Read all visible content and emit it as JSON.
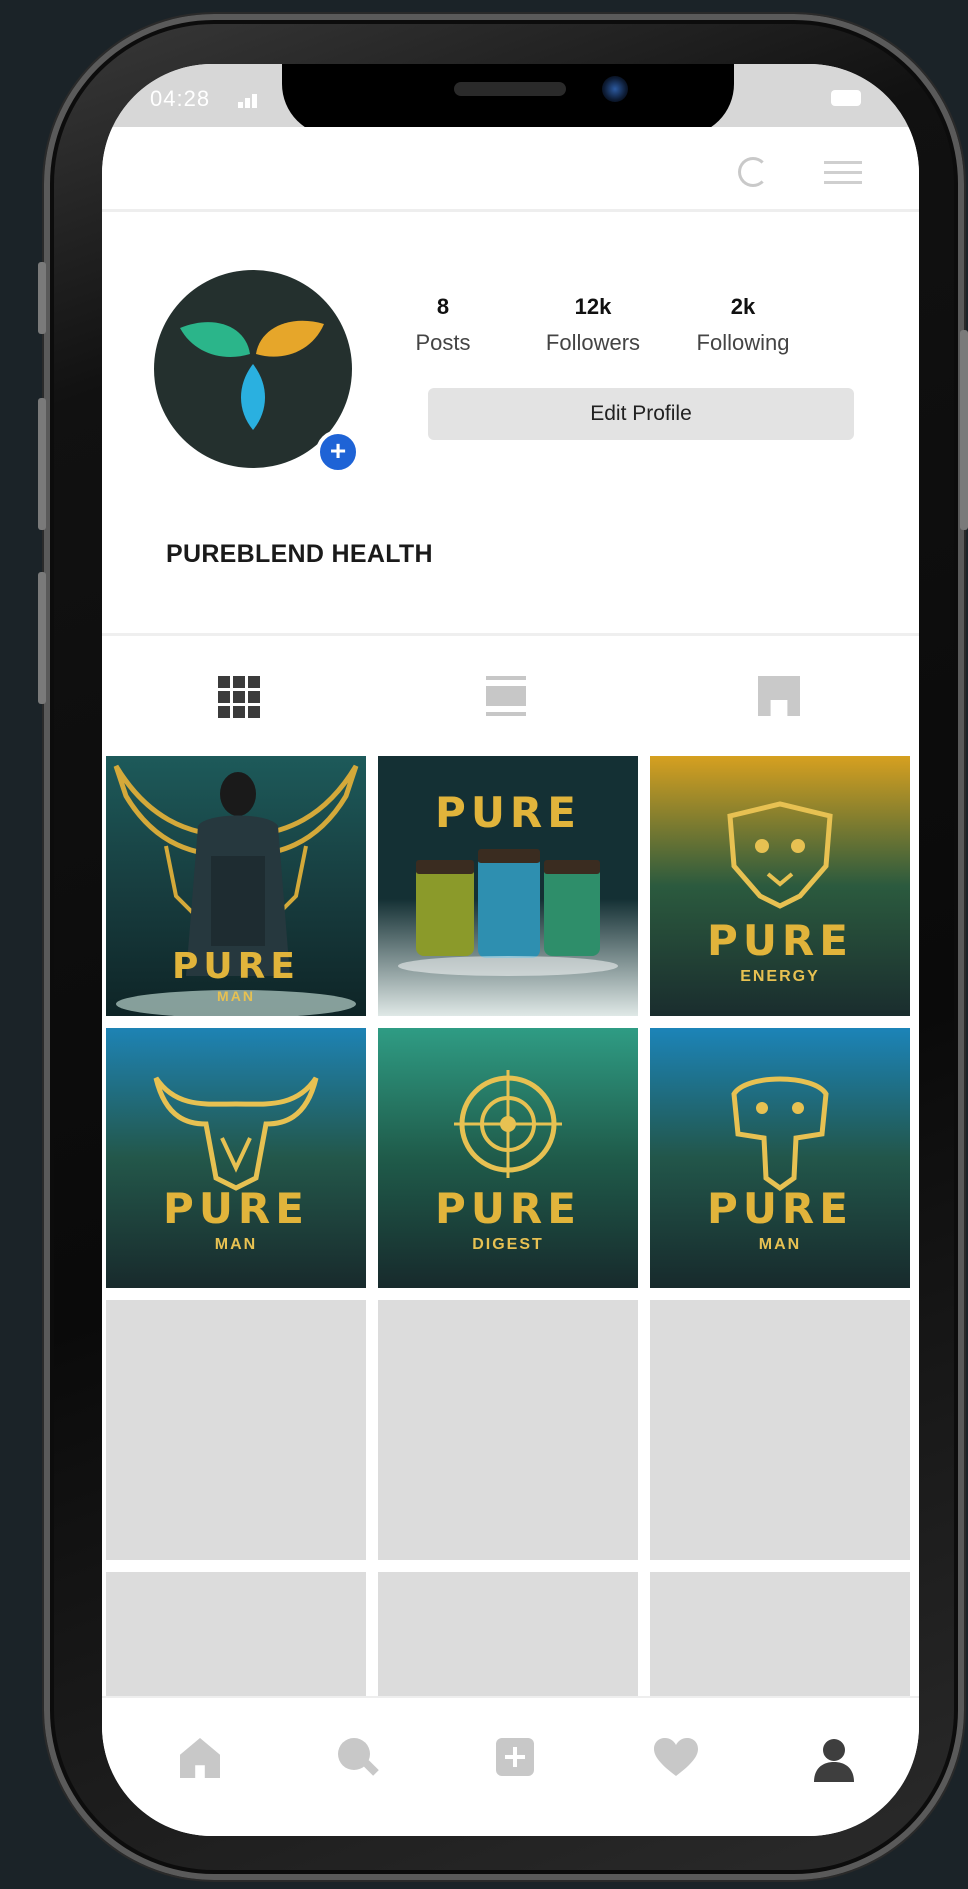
{
  "status_bar": {
    "time": "04:28"
  },
  "profile": {
    "name": "PUREBLEND HEALTH",
    "stats": {
      "posts_value": "8",
      "posts_label": "Posts",
      "followers_value": "12k",
      "followers_label": "Followers",
      "following_value": "2k",
      "following_label": "Following"
    },
    "edit_profile_label": "Edit Profile"
  },
  "tabs": [
    "grid-tab",
    "feed-tab",
    "tagged-tab"
  ],
  "posts": [
    {
      "brand": "PURE",
      "sub": "MAN"
    },
    {
      "brand": "PURE",
      "sub": ""
    },
    {
      "brand": "PURE",
      "sub": "ENERGY"
    },
    {
      "brand": "PURE",
      "sub": "MAN"
    },
    {
      "brand": "PURE",
      "sub": "DIGEST"
    },
    {
      "brand": "PURE",
      "sub": "MAN"
    }
  ],
  "colors": {
    "logo_green": "#2bb58a",
    "logo_gold": "#e6a62a",
    "logo_blue": "#2ab0e0",
    "brand_gold": "#e1b43b",
    "accent_blue": "#1e63d6"
  },
  "bottom_nav": [
    "home-icon",
    "search-icon",
    "add-post-icon",
    "heart-icon",
    "profile-icon"
  ]
}
